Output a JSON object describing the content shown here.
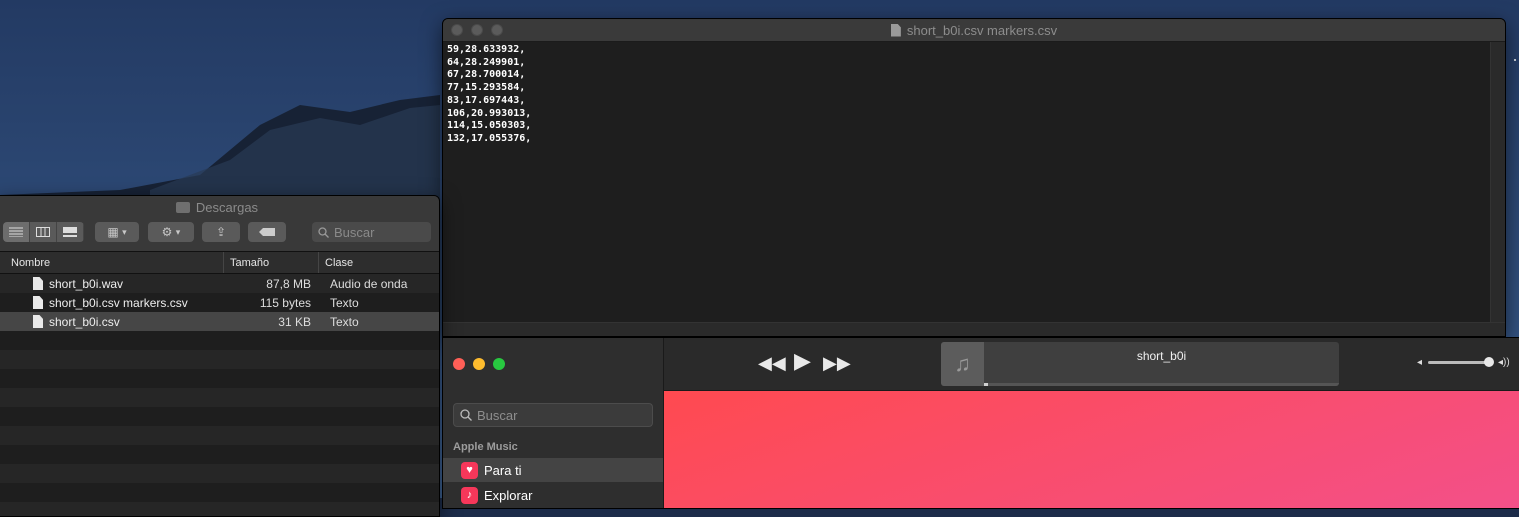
{
  "textedit": {
    "title": "short_b0i.csv markers.csv",
    "lines": [
      "59,28.633932,",
      "64,28.249901,",
      "67,28.700014,",
      "77,15.293584,",
      "83,17.697443,",
      "106,20.993013,",
      "114,15.050303,",
      "132,17.055376,"
    ]
  },
  "finder": {
    "title": "Descargas",
    "search_placeholder": "Buscar",
    "columns": {
      "name": "Nombre",
      "size": "Tamaño",
      "kind": "Clase"
    },
    "files": [
      {
        "name": "short_b0i.wav",
        "size": "87,8 MB",
        "kind": "Audio de onda",
        "icon": "audio-file-icon"
      },
      {
        "name": "short_b0i.csv markers.csv",
        "size": "115 bytes",
        "kind": "Texto",
        "icon": "text-file-icon"
      },
      {
        "name": "short_b0i.csv",
        "size": "31 KB",
        "kind": "Texto",
        "icon": "text-file-icon",
        "selected": true
      }
    ]
  },
  "music": {
    "search_placeholder": "Buscar",
    "section_label": "Apple Music",
    "nav": [
      {
        "label": "Para ti",
        "icon": "heart-icon",
        "active": true
      },
      {
        "label": "Explorar",
        "icon": "music-note-icon",
        "active": false
      }
    ],
    "now_playing": "short_b0i",
    "progress": 0.01,
    "volume": 0.95,
    "colors": {
      "hero_start": "#ff4a50",
      "hero_end": "#f3508a"
    }
  }
}
